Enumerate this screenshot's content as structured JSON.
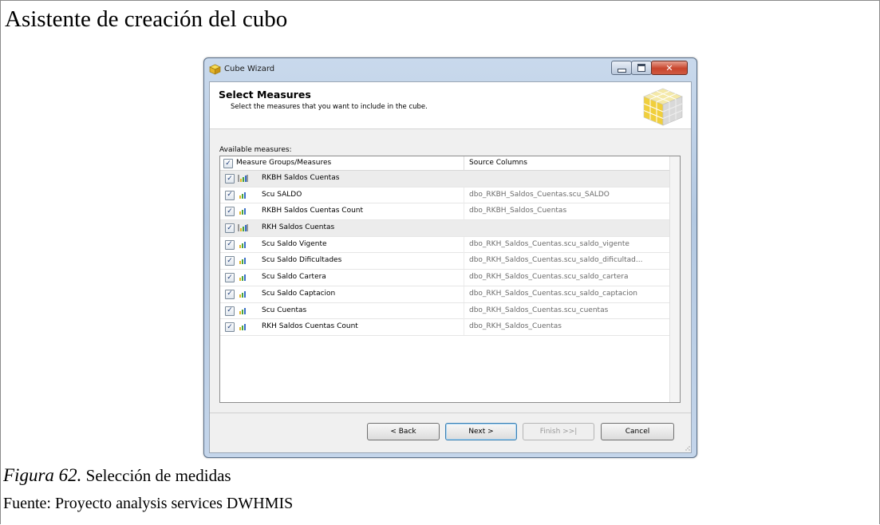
{
  "document": {
    "title": "Asistente de creación del cubo",
    "caption_label": "Figura 62.",
    "caption_text": " Selección de medidas",
    "source": "Fuente: Proyecto analysis services DWHMIS"
  },
  "window": {
    "title": "Cube Wizard",
    "icon": "cube-icon",
    "controls": [
      "minimize-icon",
      "maximize-icon",
      "close-icon"
    ]
  },
  "wizard": {
    "heading": "Select Measures",
    "subheading": "Select the measures that you want to include in the cube.",
    "available_label": "Available measures:",
    "columns": {
      "measures": "Measure Groups/Measures",
      "source": "Source Columns"
    },
    "header_checked": true,
    "rows": [
      {
        "name": "RKBH Saldos Cuentas",
        "source": "",
        "group": true,
        "checked": true
      },
      {
        "name": "Scu SALDO",
        "source": "dbo_RKBH_Saldos_Cuentas.scu_SALDO",
        "group": false,
        "checked": true
      },
      {
        "name": "RKBH Saldos Cuentas Count",
        "source": "dbo_RKBH_Saldos_Cuentas",
        "group": false,
        "checked": true
      },
      {
        "name": "RKH Saldos Cuentas",
        "source": "",
        "group": true,
        "checked": true
      },
      {
        "name": "Scu Saldo Vigente",
        "source": "dbo_RKH_Saldos_Cuentas.scu_saldo_vigente",
        "group": false,
        "checked": true
      },
      {
        "name": "Scu Saldo Dificultades",
        "source": "dbo_RKH_Saldos_Cuentas.scu_saldo_dificultad...",
        "group": false,
        "checked": true
      },
      {
        "name": "Scu Saldo Cartera",
        "source": "dbo_RKH_Saldos_Cuentas.scu_saldo_cartera",
        "group": false,
        "checked": true
      },
      {
        "name": "Scu Saldo Captacion",
        "source": "dbo_RKH_Saldos_Cuentas.scu_saldo_captacion",
        "group": false,
        "checked": true
      },
      {
        "name": "Scu Cuentas",
        "source": "dbo_RKH_Saldos_Cuentas.scu_cuentas",
        "group": false,
        "checked": true
      },
      {
        "name": "RKH Saldos Cuentas Count",
        "source": "dbo_RKH_Saldos_Cuentas",
        "group": false,
        "checked": true
      }
    ],
    "buttons": {
      "back": "< Back",
      "next": "Next >",
      "finish": "Finish >>|",
      "cancel": "Cancel"
    }
  },
  "colors": {
    "titlebar": "#c4d5ea",
    "close_button": "#c8452d",
    "bar_yellow": "#e2b825",
    "bar_green": "#4aa33a",
    "bar_blue": "#3a6fc7"
  }
}
